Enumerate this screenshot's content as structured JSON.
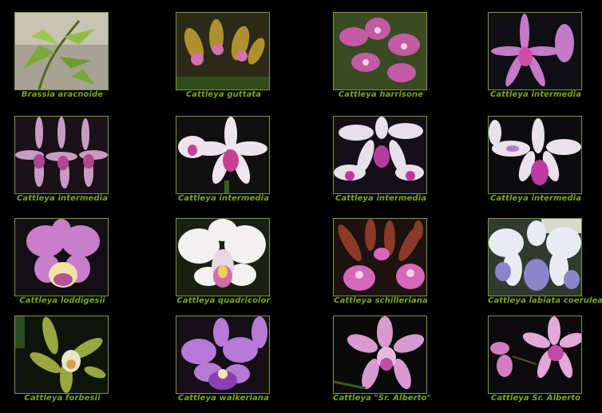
{
  "colors": {
    "background": "#000000",
    "caption": "#78a81c",
    "thumb_border": "#7d9a3a"
  },
  "gallery": {
    "items": [
      {
        "caption": "Brassia aracnoide"
      },
      {
        "caption": "Cattleya guttata"
      },
      {
        "caption": "Cattleya harrisone"
      },
      {
        "caption": "Cattleya intermedia"
      },
      {
        "caption": "Cattleya intermedia"
      },
      {
        "caption": "Cattleya intermedia"
      },
      {
        "caption": "Cattleya intermedia"
      },
      {
        "caption": "Cattleya intermedia"
      },
      {
        "caption": "Cattleya loddigesii"
      },
      {
        "caption": "Cattleya quadricolor"
      },
      {
        "caption": "Cattleya schilleriana"
      },
      {
        "caption": "Cattleya labiata coerulea"
      },
      {
        "caption": "Cattleya forbesii"
      },
      {
        "caption": "Cattleya walkeriana"
      },
      {
        "caption": "Cattleya \"Sr. Alberto\""
      },
      {
        "caption": "Cattleya Sr. Alberto"
      }
    ]
  }
}
